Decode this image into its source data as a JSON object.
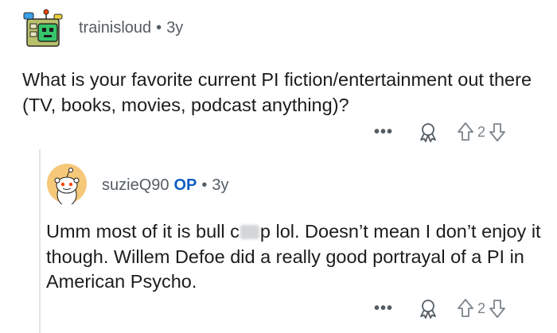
{
  "comments": [
    {
      "username": "trainisloud",
      "separator": "•",
      "age": "3y",
      "body": "What is your favorite current PI fiction/entertainment out there (TV, books, movies, podcast anything)?",
      "more_label": "•••",
      "score": "2",
      "avatar_icon": "robot-snoo-avatar-icon"
    },
    {
      "username": "suzieQ90",
      "op_badge": "OP",
      "separator": "•",
      "age": "3y",
      "body_before": "Umm most of it is bull c",
      "body_after": "p lol. Doesn’t mean I don’t enjoy it though. Willem Defoe did a really good portrayal of a PI in American Psycho.",
      "more_label": "•••",
      "score": "2",
      "avatar_icon": "default-snoo-avatar-icon"
    }
  ],
  "colors": {
    "text": "#1c1c1c",
    "meta": "#545d63",
    "op_badge": "#0f5ec2",
    "thread_line": "#e3e6e8"
  }
}
